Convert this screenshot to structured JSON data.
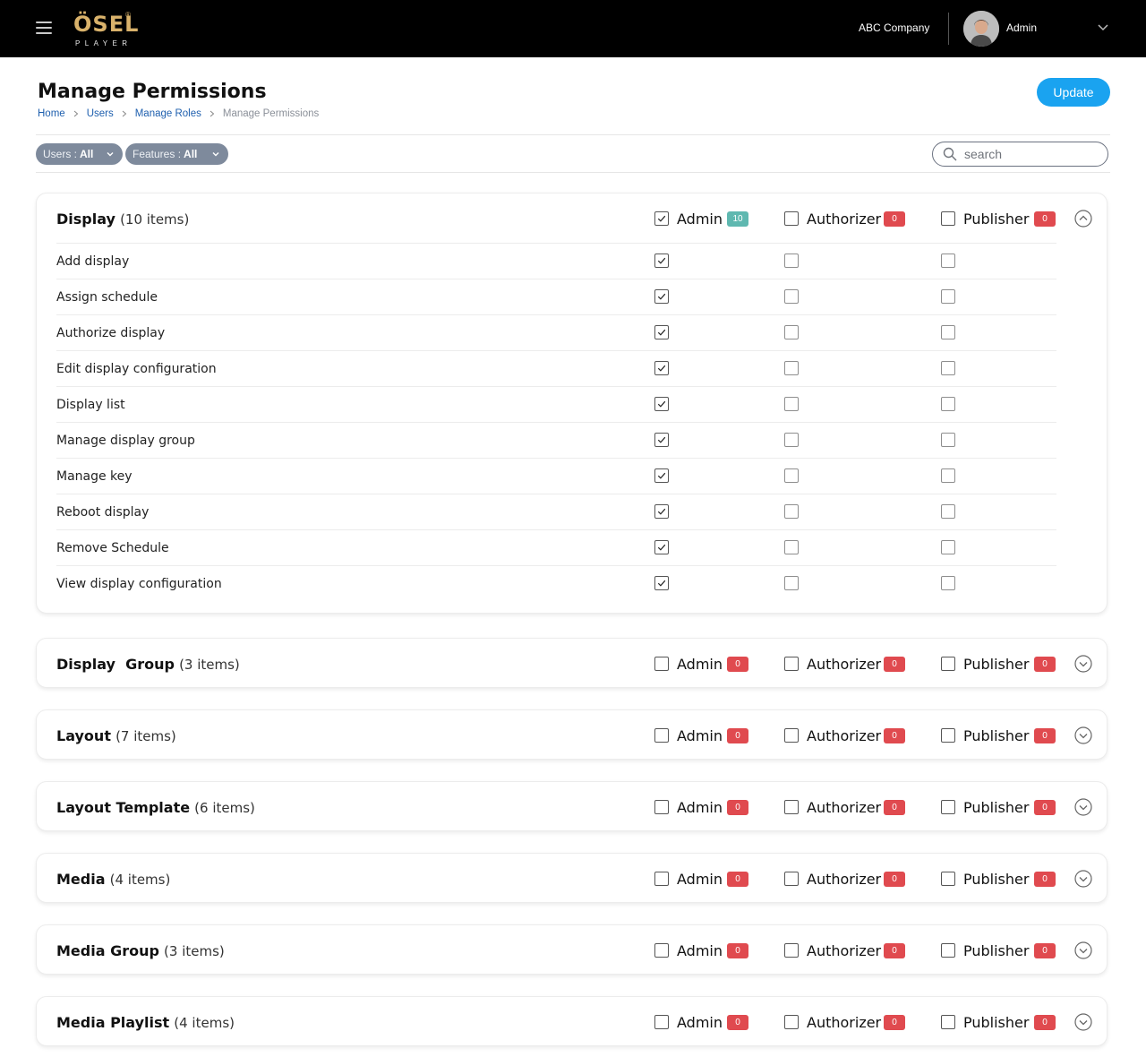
{
  "header": {
    "logo_main": "ÖSEL",
    "logo_reg": "®",
    "logo_sub": "PLAYER",
    "company": "ABC Company",
    "user_name": "Admin"
  },
  "page": {
    "title": "Manage Permissions",
    "update_label": "Update",
    "breadcrumb": [
      "Home",
      "Users",
      "Manage Roles",
      "Manage Permissions"
    ]
  },
  "filters": {
    "users_label": "Users :",
    "users_value": "All",
    "features_label": "Features :",
    "features_value": "All"
  },
  "search": {
    "placeholder": "search"
  },
  "roles": [
    "Admin",
    "Authorizer",
    "Publisher"
  ],
  "sections": [
    {
      "name": "Display",
      "count": "(10 items)",
      "expanded": true,
      "badges": [
        "10",
        "0",
        "0"
      ],
      "header_checked": [
        true,
        false,
        false
      ],
      "items": [
        {
          "label": "Add display",
          "checked": [
            true,
            false,
            false
          ]
        },
        {
          "label": "Assign schedule",
          "checked": [
            true,
            false,
            false
          ]
        },
        {
          "label": "Authorize display",
          "checked": [
            true,
            false,
            false
          ]
        },
        {
          "label": "Edit display configuration",
          "checked": [
            true,
            false,
            false
          ]
        },
        {
          "label": "Display list",
          "checked": [
            true,
            false,
            false
          ]
        },
        {
          "label": "Manage display group",
          "checked": [
            true,
            false,
            false
          ]
        },
        {
          "label": "Manage key",
          "checked": [
            true,
            false,
            false
          ]
        },
        {
          "label": "Reboot display",
          "checked": [
            true,
            false,
            false
          ]
        },
        {
          "label": "Remove Schedule",
          "checked": [
            true,
            false,
            false
          ]
        },
        {
          "label": "View display configuration",
          "checked": [
            true,
            false,
            false
          ]
        }
      ]
    },
    {
      "name": "Display  Group",
      "count": "(3 items)",
      "expanded": false,
      "badges": [
        "0",
        "0",
        "0"
      ],
      "header_checked": [
        false,
        false,
        false
      ]
    },
    {
      "name": "Layout",
      "count": "(7 items)",
      "expanded": false,
      "badges": [
        "0",
        "0",
        "0"
      ],
      "header_checked": [
        false,
        false,
        false
      ]
    },
    {
      "name": "Layout Template",
      "count": "(6 items)",
      "expanded": false,
      "badges": [
        "0",
        "0",
        "0"
      ],
      "header_checked": [
        false,
        false,
        false
      ]
    },
    {
      "name": "Media",
      "count": "(4 items)",
      "expanded": false,
      "badges": [
        "0",
        "0",
        "0"
      ],
      "header_checked": [
        false,
        false,
        false
      ]
    },
    {
      "name": "Media Group",
      "count": "(3 items)",
      "expanded": false,
      "badges": [
        "0",
        "0",
        "0"
      ],
      "header_checked": [
        false,
        false,
        false
      ]
    },
    {
      "name": "Media Playlist",
      "count": "(4 items)",
      "expanded": false,
      "badges": [
        "0",
        "0",
        "0"
      ],
      "header_checked": [
        false,
        false,
        false
      ]
    }
  ],
  "colors": {
    "accent": "#1aa3f0",
    "badge_zero": "#e04a4f",
    "badge_count": "#5fb8b0",
    "logo_gold": "#d9b26b"
  },
  "icons": {
    "menu": "hamburger-icon",
    "chevron": "chevron-down-icon",
    "search": "search-icon",
    "collapse": "circle-chevron-up-icon",
    "expand": "circle-chevron-down-icon",
    "check": "check-icon"
  }
}
